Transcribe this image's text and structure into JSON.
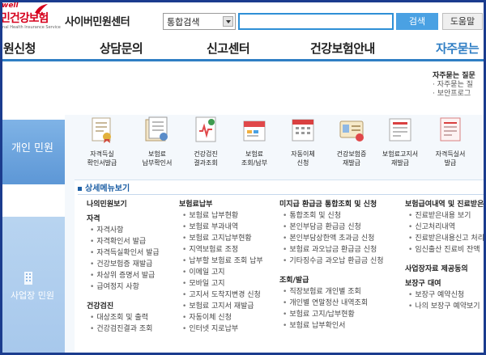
{
  "header": {
    "logo_tag": "well",
    "logo_name": "민건강보험",
    "logo_sub": "onal Health Insurance Service",
    "site_title": "사이버민원센터",
    "search_select_value": "통합검색",
    "search_placeholder": "",
    "search_button": "검색",
    "help_button": "도움말"
  },
  "nav": {
    "items": [
      {
        "label": "원신청"
      },
      {
        "label": "상담문의"
      },
      {
        "label": "신고센터"
      },
      {
        "label": "건강보험안내"
      },
      {
        "label": "자주묻는"
      }
    ]
  },
  "faq": {
    "title": "자주묻는 질문",
    "items": [
      "자주묻는 질",
      "보안프로그"
    ]
  },
  "sidebar": {
    "personal_label": "개인 민원",
    "business_label": "사업장 민원"
  },
  "icon_menu": [
    {
      "line1": "자격득실",
      "line2": "확인서발급",
      "icon": "certificate-icon"
    },
    {
      "line1": "보험료",
      "line2": "납부확인서",
      "icon": "document-icon"
    },
    {
      "line1": "건강검진",
      "line2": "결과조회",
      "icon": "health-chart-icon"
    },
    {
      "line1": "보험료",
      "line2": "조회/납부",
      "icon": "bill-icon"
    },
    {
      "line1": "자동이체",
      "line2": "신청",
      "icon": "calendar-icon"
    },
    {
      "line1": "건강보험증",
      "line2": "재발급",
      "icon": "card-icon"
    },
    {
      "line1": "보험료고지서",
      "line2": "재발급",
      "icon": "receipt-icon"
    },
    {
      "line1": "자격득실서",
      "line2": "발급",
      "icon": "form-icon"
    }
  ],
  "detail_title": "상세메뉴보기",
  "columns": [
    {
      "heading": "나의민원보기",
      "groups": [
        {
          "title": "자격",
          "items": [
            "자격사항",
            "자격확인서 발급",
            "자격득실확인서 발급",
            "건강보험증 재발급",
            "차상위 증명서 발급",
            "급여정지 사항"
          ]
        },
        {
          "title": "건강검진",
          "items": [
            "대상조회 및 출력",
            "건강검진결과 조회"
          ]
        }
      ]
    },
    {
      "heading": "보험료납부",
      "groups": [
        {
          "title": "",
          "items": [
            "보험료 납부현황",
            "보험료 부과내역",
            "보험료 고지납부현황",
            "지역보험료 조정",
            "납부할 보험료 조회 납부",
            "이메일 고지",
            "모바일 고지",
            "고지서 도착지변경 신청",
            "보험료 고지서 재발급",
            "자동이체 신청",
            "인터넷 지로납부"
          ]
        }
      ]
    },
    {
      "heading": "미지급 환급금 통합조회 및 신청",
      "groups": [
        {
          "title": "",
          "items": [
            "통합조회 및 신청",
            "본인부담금 환급금 신청",
            "본인부담상한액 초과금 신청",
            "보험료 과오납금 환급금 신청",
            "기타징수금 과오납 환급금 신청"
          ]
        },
        {
          "title": "조회/발급",
          "items": [
            "직장보험료 개인별 조회",
            "개인별 연말정산 내역조회",
            "보험료 고지/납부현황",
            "보험료 납부확인서"
          ]
        }
      ]
    },
    {
      "heading": "보험급여내역 및 진료받은",
      "groups": [
        {
          "title": "",
          "items": [
            "진료받은내용 보기",
            "신고처리내역",
            "진료받은내용신고 처리",
            "임신출산 진료비 잔액"
          ]
        },
        {
          "title": "사업장자료 제공동의",
          "items": []
        },
        {
          "title": "보장구 대여",
          "items": [
            "보장구 예약신청",
            "나의 보장구 예약보기"
          ]
        }
      ]
    }
  ],
  "colors": {
    "brand_red": "#d6001c",
    "nav_blue": "#2f7ec4",
    "search_blue": "#4aa1e3",
    "sidebar_blue": "#6aa3dd",
    "frame_navy": "#1b3c8e"
  }
}
